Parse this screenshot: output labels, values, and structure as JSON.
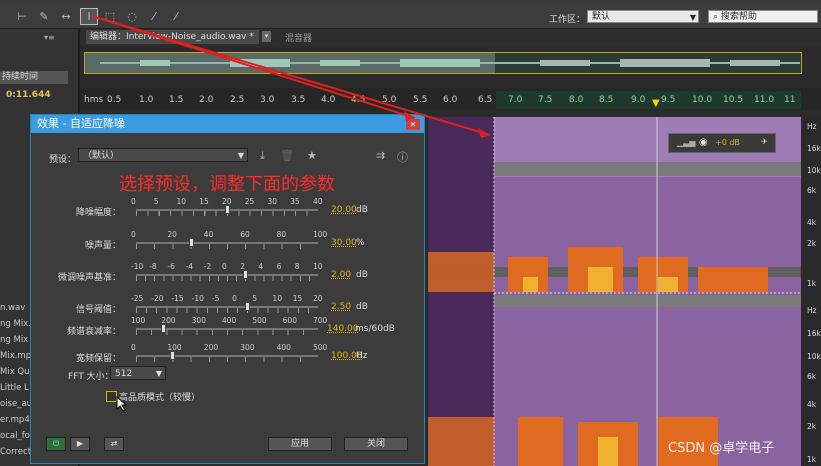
{
  "toolbar": {
    "workspace_label": "工作区：",
    "workspace_value": "默认",
    "search_placeholder": "搜索帮助"
  },
  "left_panel": {
    "duration_label": "持续时间",
    "duration_value": "0:11.644",
    "files": [
      "n.wav",
      "ng Mix.r",
      "ng Mix (",
      "Mix.mp3",
      "Mix Qui",
      " Little L",
      "oise_au",
      "er.mp4",
      "ocal_for",
      "Correct"
    ]
  },
  "editor": {
    "tab_label": "编辑器：Interview-Noise_audio.wav *",
    "mixer_label": "混音器"
  },
  "ruler": {
    "unit": "hms",
    "ticks": [
      "0.5",
      "1.0",
      "1.5",
      "2.0",
      "2.5",
      "3.0",
      "3.5",
      "4.0",
      "4.5",
      "5.0",
      "5.5",
      "6.0",
      "6.5",
      "7.0",
      "7.5",
      "8.0",
      "8.5",
      "9.0",
      "9.5",
      "10.0",
      "10.5",
      "11.0",
      "11"
    ]
  },
  "spectrum": {
    "hz_labels": [
      "Hz",
      "16k",
      "10k",
      "6k",
      "4k",
      "2k",
      "1k",
      "Hz",
      "16k",
      "10k",
      "6k",
      "4k",
      "2k",
      "1k"
    ],
    "volume_value": "+0 dB"
  },
  "dialog": {
    "title": "效果 - 自适应降噪",
    "preset_label": "预设：",
    "preset_value": "（默认）",
    "annotation": "选择预设，调整下面的参数",
    "params": [
      {
        "label": "降噪幅度：",
        "scale": [
          "0",
          "5",
          "10",
          "15",
          "20",
          "25",
          "30",
          "35",
          "40"
        ],
        "value": "20.00",
        "unit": "dB",
        "level": 0.5
      },
      {
        "label": "噪声量：",
        "scale": [
          "0",
          "20",
          "40",
          "60",
          "80",
          "100"
        ],
        "value": "30.00",
        "unit": "%",
        "level": 0.3
      },
      {
        "label": "微调噪声基准：",
        "scale": [
          "-10",
          "-8",
          "-6",
          "-4",
          "-2",
          "0",
          "2",
          "4",
          "6",
          "8",
          "10"
        ],
        "value": "2.00",
        "unit": "dB",
        "level": 0.6
      },
      {
        "label": "信号阈值：",
        "scale": [
          "-25",
          "-20",
          "-15",
          "-10",
          "-5",
          "0",
          "5",
          "10",
          "15",
          "20"
        ],
        "value": "2.50",
        "unit": "dB",
        "level": 0.61
      },
      {
        "label": "频谱衰减率：",
        "scale": [
          "100",
          "200",
          "300",
          "400",
          "500",
          "600",
          "700"
        ],
        "value": "140.00",
        "unit": "ms/60dB",
        "level": 0.15
      },
      {
        "label": "宽频保留：",
        "scale": [
          "0",
          "100",
          "200",
          "300",
          "400",
          "500"
        ],
        "value": "100.00",
        "unit": "Hz",
        "level": 0.2
      }
    ],
    "fft_label": "FFT 大小：",
    "fft_value": "512",
    "hq_label": "高品质模式（较慢）",
    "apply_label": "应用",
    "close_label": "关闭"
  },
  "watermark": "CSDN @卓学电子",
  "colors": {
    "accent": "#3b9ae0",
    "value": "#e0b020",
    "annotation": "#ff2a2a"
  }
}
